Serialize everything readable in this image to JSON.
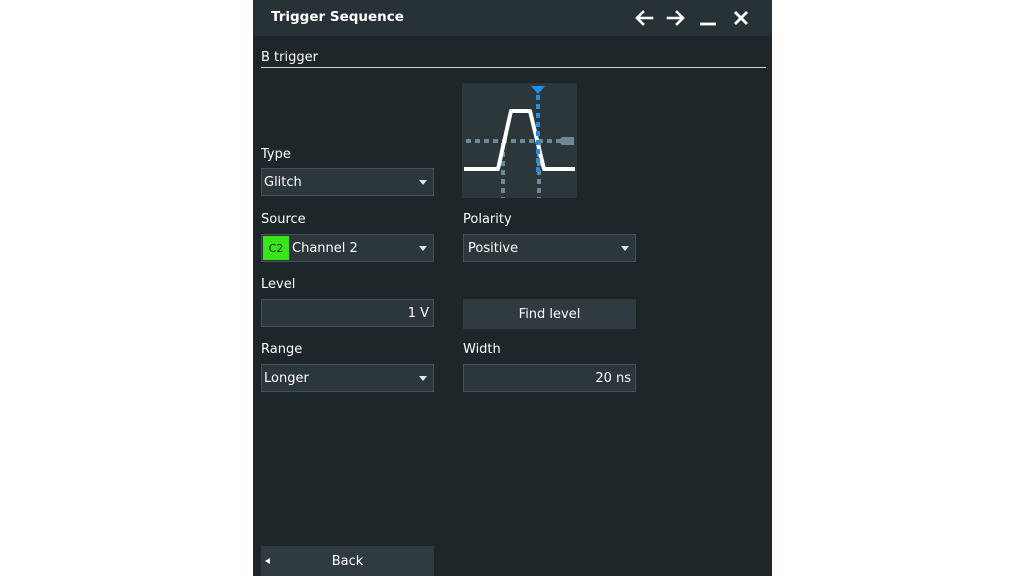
{
  "window": {
    "title": "Trigger Sequence",
    "icons": [
      "arrow-left-icon",
      "arrow-right-icon",
      "minimize-icon",
      "close-icon"
    ]
  },
  "section": {
    "label": "B trigger"
  },
  "type": {
    "label": "Type",
    "value": "Glitch"
  },
  "source": {
    "label": "Source",
    "chip": "C2",
    "value": "Channel 2",
    "chip_color": "#39e41c"
  },
  "polarity": {
    "label": "Polarity",
    "value": "Positive"
  },
  "level": {
    "label": "Level",
    "value": "1 V"
  },
  "find_level": {
    "label": "Find level"
  },
  "range": {
    "label": "Range",
    "value": "Longer"
  },
  "width": {
    "label": "Width",
    "value": "20 ns"
  },
  "back": {
    "label": "Back"
  },
  "colors": {
    "accent": "#1e8ee6",
    "panel": "#1d2629",
    "titlebar": "#273236"
  }
}
